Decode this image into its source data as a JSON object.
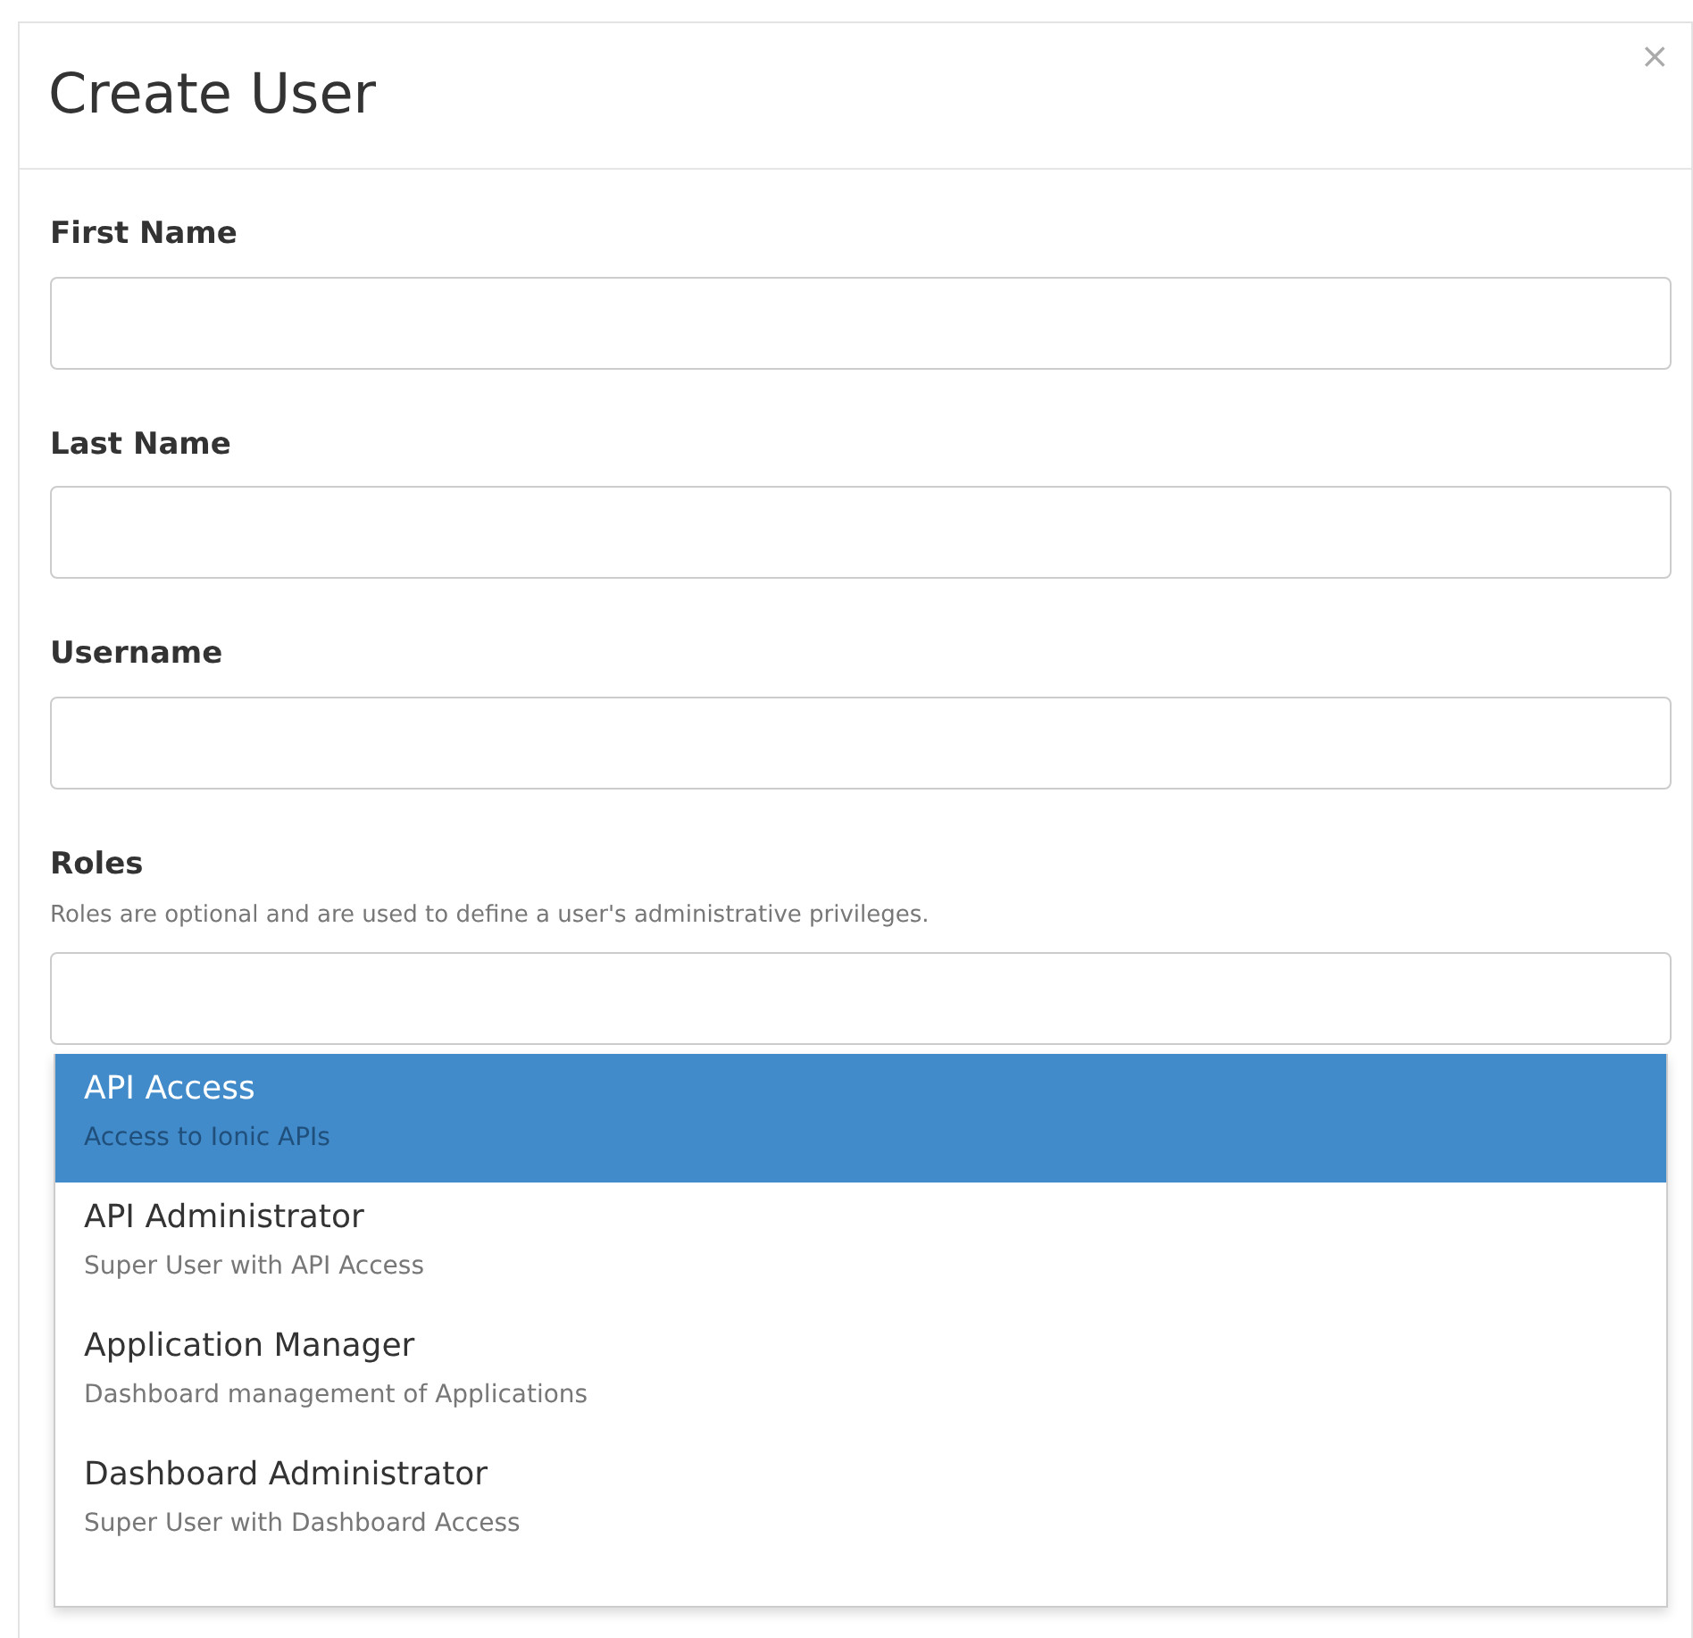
{
  "modal": {
    "title": "Create User",
    "close": "×"
  },
  "fields": [
    {
      "label": "First Name"
    },
    {
      "label": "Last Name"
    },
    {
      "label": "Username"
    },
    {
      "label": "Roles",
      "help": "Roles are optional and are used to define a user's administrative privileges."
    }
  ],
  "role_options": [
    {
      "name": "API Access",
      "description": "Access to Ionic APIs",
      "selected": true
    },
    {
      "name": "API Administrator",
      "description": "Super User with API Access",
      "selected": false
    },
    {
      "name": "Application Manager",
      "description": "Dashboard management of Applications",
      "selected": false
    },
    {
      "name": "Dashboard Administrator",
      "description": "Super User with Dashboard Access",
      "selected": false
    }
  ]
}
